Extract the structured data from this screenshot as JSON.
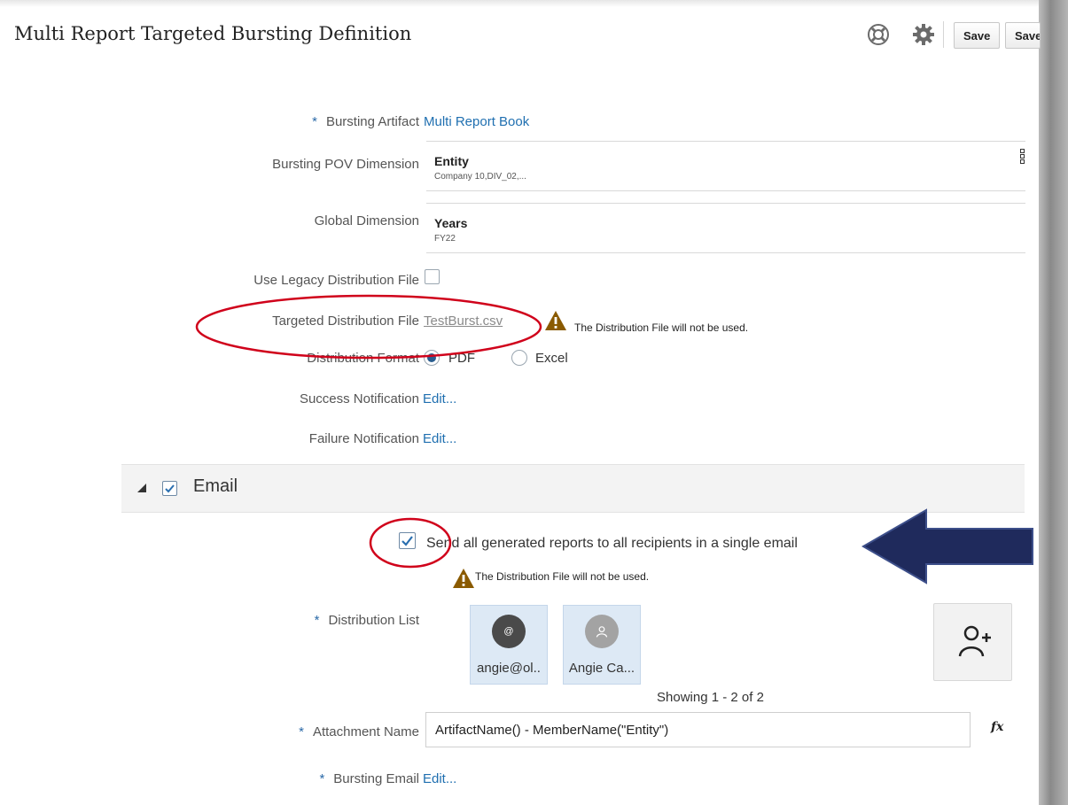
{
  "header": {
    "title": "Multi Report Targeted Bursting Definition",
    "help_icon": "lifebuoy-icon",
    "settings_icon": "gear-icon",
    "save_label": "Save",
    "save_as_label": "Save"
  },
  "form": {
    "bursting_artifact": {
      "label": "Bursting Artifact",
      "required": "*",
      "value": "Multi Report Book"
    },
    "pov_dimension": {
      "label": "Bursting POV Dimension",
      "dimension": "Entity",
      "members": "Company 10,DIV_02,..."
    },
    "global_dimension": {
      "label": "Global Dimension",
      "dimension": "Years",
      "members": "FY22"
    },
    "legacy_file": {
      "label": "Use Legacy Distribution File",
      "checked": false
    },
    "targeted_file": {
      "label": "Targeted Distribution File",
      "value": "TestBurst.csv",
      "warning": "The Distribution File will not be used."
    },
    "distribution_format": {
      "label": "Distribution Format",
      "options": [
        "PDF",
        "Excel"
      ],
      "selected": "PDF"
    },
    "success_notification": {
      "label": "Success Notification",
      "link": "Edit..."
    },
    "failure_notification": {
      "label": "Failure Notification",
      "link": "Edit..."
    }
  },
  "email_section": {
    "title": "Email",
    "enabled": true,
    "single_email": {
      "label": "Send all generated reports to all recipients in a single email",
      "checked": true,
      "warning": "The Distribution File will not be used."
    },
    "distribution_list": {
      "label": "Distribution List",
      "required": "*",
      "recipients": [
        {
          "name": "angie@ol..",
          "avatar": "@",
          "avatar_color": "#4a4a4a"
        },
        {
          "name": "Angie Ca...",
          "avatar": "person-icon",
          "avatar_color": "#a3a3a3"
        }
      ],
      "add_icon": "add-user-icon",
      "showing": "Showing 1 - 2 of 2"
    },
    "attachment_name": {
      "label": "Attachment Name",
      "required": "*",
      "value": "ArtifactName() - MemberName(\"Entity\")",
      "fx": "fx"
    },
    "bursting_email": {
      "label": "Bursting Email",
      "required": "*",
      "link": "Edit..."
    }
  },
  "colors": {
    "link": "#1f6fb0",
    "annotation_red": "#d0021b",
    "arrow_fill": "#1f2a5c",
    "warning": "#8a5a00"
  }
}
